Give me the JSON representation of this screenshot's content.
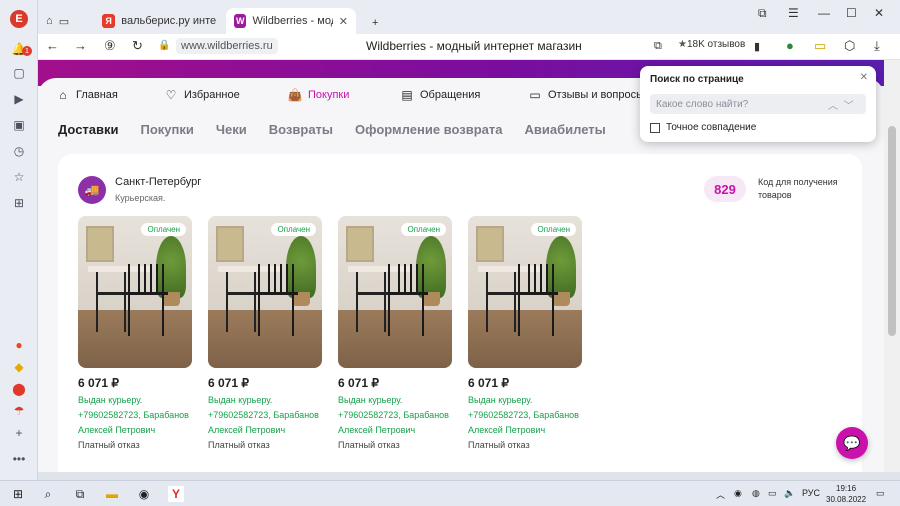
{
  "browser": {
    "profile_letter": "E",
    "notification_count": "1",
    "tabs": [
      {
        "label": "вальберис.ру интернет м",
        "favicon": "Я",
        "active": false
      },
      {
        "label": "Wildberries - модный и",
        "favicon": "W",
        "active": true
      }
    ],
    "new_tab": "+",
    "address": "www.wildberries.ru",
    "page_title": "Wildberries - модный интернет магазин",
    "reviews": "18K отзывов"
  },
  "site": {
    "nav": [
      {
        "label": "Главная",
        "icon": "home-icon"
      },
      {
        "label": "Избранное",
        "icon": "heart-icon"
      },
      {
        "label": "Покупки",
        "icon": "bag-icon",
        "active": true
      },
      {
        "label": "Обращения",
        "icon": "message-icon"
      },
      {
        "label": "Отзывы и вопросы",
        "icon": "reviews-icon"
      }
    ],
    "tabs": [
      {
        "label": "Доставки",
        "active": true
      },
      {
        "label": "Покупки"
      },
      {
        "label": "Чеки"
      },
      {
        "label": "Возвраты"
      },
      {
        "label": "Оформление возврата"
      },
      {
        "label": "Авиабилеты"
      }
    ],
    "delivery": {
      "city": "Санкт-Петербург",
      "address": "Курьерская.",
      "code": "829",
      "code_label": "Код для получения товаров"
    },
    "products": [
      {
        "badge": "Оплачен",
        "price": "6 071 ₽",
        "status": "Выдан курьеру. +79602582723, Барабанов Алексей Петрович",
        "refund": "Платный отказ"
      },
      {
        "badge": "Оплачен",
        "price": "6 071 ₽",
        "status": "Выдан курьеру. +79602582723, Барабанов Алексей Петрович",
        "refund": "Платный отказ"
      },
      {
        "badge": "Оплачен",
        "price": "6 071 ₽",
        "status": "Выдан курьеру. +79602582723, Барабанов Алексей Петрович",
        "refund": "Платный отказ"
      },
      {
        "badge": "Оплачен",
        "price": "6 071 ₽",
        "status": "Выдан курьеру. +79602582723, Барабанов Алексей Петрович",
        "refund": "Платный отказ"
      }
    ]
  },
  "find": {
    "title": "Поиск по странице",
    "placeholder": "Какое слово найти?",
    "exact_match": "Точное совпадение"
  },
  "taskbar": {
    "lang": "РУС",
    "time": "19:16",
    "date": "30.08.2022"
  },
  "colors": {
    "brand": "#cb11ab",
    "paid": "#13a24a"
  }
}
